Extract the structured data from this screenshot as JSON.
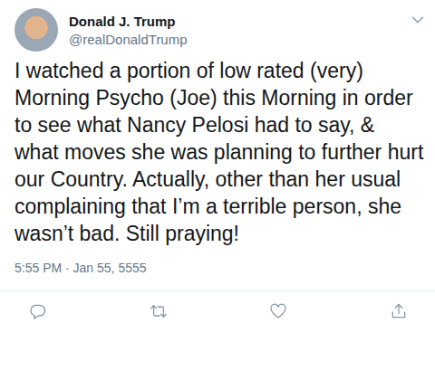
{
  "author": {
    "name": "Donald J. Trump",
    "handle": "@realDonaldTrump"
  },
  "tweet": {
    "text": "I watched a portion of low rated (very) Morning Psycho (Joe) this Morning in order to see what Nancy Pelosi had to say, & what moves she was planning to further hurt our Country. Actually, other than her usual complaining that I’m a terrible person, she wasn’t bad. Still praying!",
    "timestamp": "5:55 PM · Jan 55, 5555"
  }
}
